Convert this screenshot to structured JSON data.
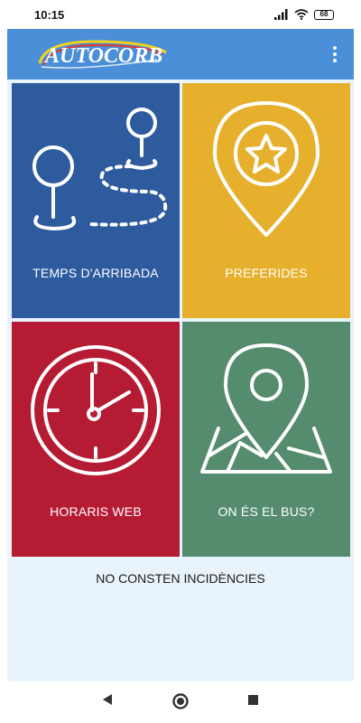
{
  "status_bar": {
    "time": "10:15",
    "battery": "68",
    "icons": [
      "signal-icon",
      "wifi-icon",
      "battery-icon"
    ]
  },
  "app_bar": {
    "logo_text": "AUTOCORB",
    "menu_icon": "more-vert-icon",
    "color": "#4a8fd8"
  },
  "tiles": [
    {
      "label": "TEMPS D'ARRIBADA",
      "icon": "route-pins-icon",
      "color": "#2d5b9e"
    },
    {
      "label": "PREFERIDES",
      "icon": "star-pin-icon",
      "color": "#e6b02c"
    },
    {
      "label": "HORARIS WEB",
      "icon": "clock-icon",
      "color": "#b51c34"
    },
    {
      "label": "ON ÉS EL BUS?",
      "icon": "map-pin-icon",
      "color": "#558c6e"
    }
  ],
  "incidents": {
    "text": "NO CONSTEN INCIDÈNCIES"
  },
  "nav_bar": {
    "buttons": [
      "back-icon",
      "home-icon",
      "recents-icon"
    ]
  }
}
